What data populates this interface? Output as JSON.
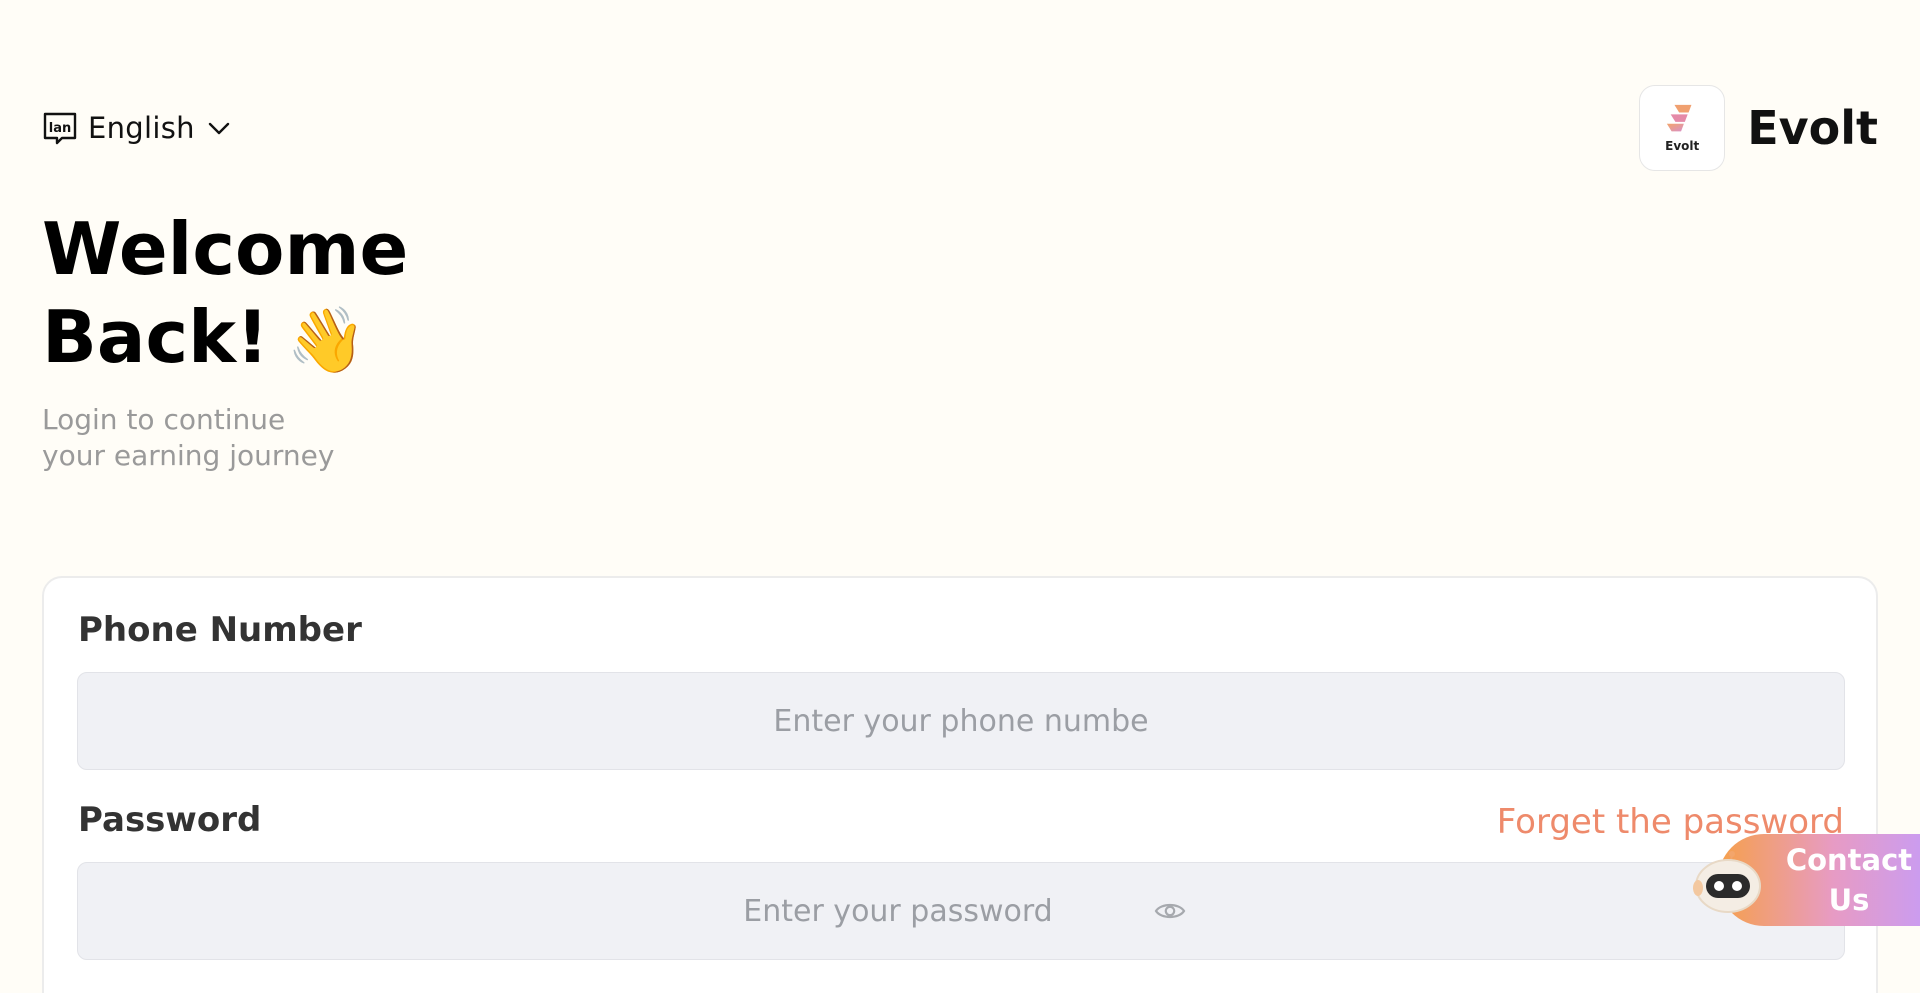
{
  "language": {
    "label": "English",
    "icon": "language-icon"
  },
  "brand": {
    "logo_text": "Evolt",
    "name": "Evolt"
  },
  "heading": {
    "line1": "Welcome",
    "line2": "Back!",
    "emoji": "👋"
  },
  "subtitle": {
    "line1": "Login to continue",
    "line2": "your earning journey"
  },
  "form": {
    "phone_label": "Phone Number",
    "phone_placeholder": "Enter your phone numbe",
    "password_label": "Password",
    "password_placeholder": "Enter your password",
    "forgot_label": "Forget the password"
  },
  "contact": {
    "label": "Contact Us"
  },
  "colors": {
    "background": "#fffdf7",
    "accent": "#ee8a6b",
    "field_bg": "#f0f1f5",
    "muted_text": "#9a9a9a"
  }
}
